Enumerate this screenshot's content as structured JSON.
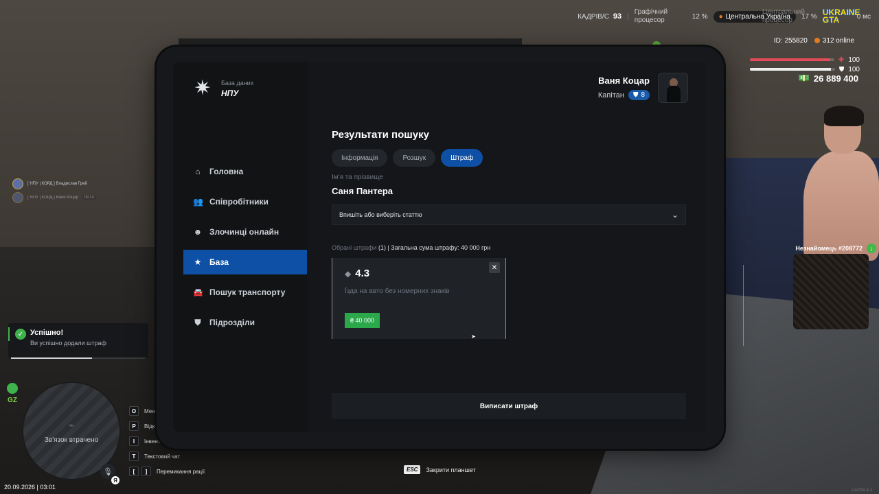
{
  "hud": {
    "fps_label": "КАДРІВ/С",
    "fps_value": "93",
    "gpu_label": "Графічний процесор",
    "gpu_percent": "12 %",
    "region": "Центральна Україна",
    "cpu_label": "Центральний процесор",
    "cpu_percent": "17 %",
    "ping": "0 мс",
    "logo": "UKRAINE GTA",
    "player_id": "ID: 255820",
    "online": "312 online",
    "health": "100",
    "armor": "100",
    "money": "26 889 400",
    "health_fraction": 0.95,
    "armor_fraction": 0.95
  },
  "stranger": {
    "label": "Незнайомець #208772"
  },
  "voice": [
    {
      "text": "[ НПУ | КОРД ] Владислав Грей"
    },
    {
      "text": "[ НПУ | КОРД ] Ваня Коцар",
      "tag": "ІКІТА"
    }
  ],
  "notification": {
    "title": "Успішно!",
    "message": "Ви успішно додали штраф"
  },
  "minimap": {
    "zone": "GZ",
    "status": "Зв'язок втрачено",
    "mic_key": "Я"
  },
  "datetime": "20.09.2026 | 03:01",
  "keybinds": [
    {
      "keys": [
        "O"
      ],
      "label": "Мен"
    },
    {
      "keys": [
        "P"
      ],
      "label": "Відк"
    },
    {
      "keys": [
        "I"
      ],
      "label": "Інвент"
    },
    {
      "keys": [
        "T"
      ],
      "label": "Текстовий чат"
    },
    {
      "keys": [
        "[",
        "]"
      ],
      "label": "Перемикання рації"
    }
  ],
  "esc_hint": {
    "key": "ESC",
    "label": "Закрити планшет"
  },
  "version": "UAGTA 4.1",
  "tablet": {
    "brand": {
      "subtitle": "База даних",
      "name": "НПУ"
    },
    "user": {
      "name": "Ваня Коцар",
      "rank": "Капітан",
      "level": "8"
    },
    "nav": [
      {
        "label": "Головна",
        "icon": "home-icon"
      },
      {
        "label": "Співробітники",
        "icon": "users-icon"
      },
      {
        "label": "Злочинці онлайн",
        "icon": "criminal-icon"
      },
      {
        "label": "База",
        "icon": "star-icon",
        "active": true
      },
      {
        "label": "Пошук транспорту",
        "icon": "car-icon"
      },
      {
        "label": "Підрозділи",
        "icon": "shield-icon"
      }
    ],
    "content": {
      "title": "Результати пошуку",
      "tabs": [
        {
          "label": "Інформація"
        },
        {
          "label": "Розшук"
        },
        {
          "label": "Штраф",
          "active": true
        }
      ],
      "name_label": "Ім'я та прізвище",
      "name_value": "Саня Пантера",
      "select_placeholder": "Впишіть або виберіть статтю",
      "summary_muted": "Обрані штрафи",
      "summary_count": "(1)",
      "summary_total": "| Загальна сума штрафу: 40 000 грн",
      "fine": {
        "code": "4.3",
        "description": "Їзда на авто без номерних знаків",
        "amount": "₴ 40 000"
      },
      "submit_label": "Виписати штраф"
    }
  }
}
